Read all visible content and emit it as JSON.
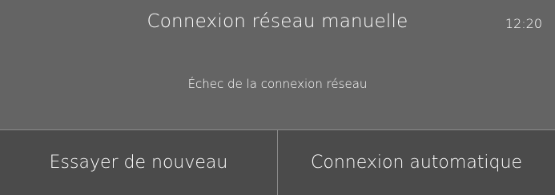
{
  "header": {
    "title": "Connexion réseau manuelle",
    "clock": "12:20"
  },
  "dialog": {
    "message": "Échec de la connexion réseau"
  },
  "buttons": {
    "retry_label": "Essayer de nouveau",
    "auto_label": "Connexion automatique"
  }
}
